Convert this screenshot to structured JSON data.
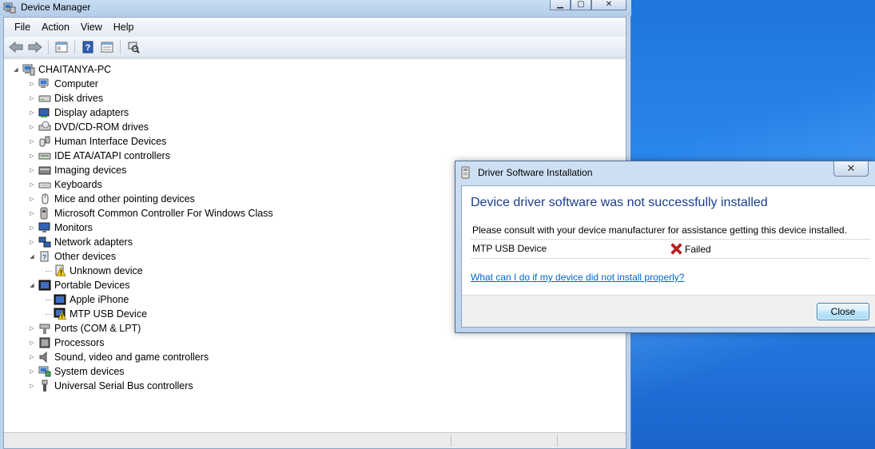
{
  "device_manager": {
    "title": "Device Manager",
    "menu": [
      "File",
      "Action",
      "View",
      "Help"
    ],
    "tree": {
      "root": "CHAITANYA-PC",
      "items": [
        {
          "label": "Computer",
          "icon": "computer-icon",
          "expanded": false
        },
        {
          "label": "Disk drives",
          "icon": "disk-drive-icon",
          "expanded": false
        },
        {
          "label": "Display adapters",
          "icon": "display-adapter-icon",
          "expanded": false
        },
        {
          "label": "DVD/CD-ROM drives",
          "icon": "dvd-drive-icon",
          "expanded": false
        },
        {
          "label": "Human Interface Devices",
          "icon": "hid-icon",
          "expanded": false
        },
        {
          "label": "IDE ATA/ATAPI controllers",
          "icon": "ide-controller-icon",
          "expanded": false
        },
        {
          "label": "Imaging devices",
          "icon": "imaging-device-icon",
          "expanded": false
        },
        {
          "label": "Keyboards",
          "icon": "keyboard-icon",
          "expanded": false
        },
        {
          "label": "Mice and other pointing devices",
          "icon": "mouse-icon",
          "expanded": false
        },
        {
          "label": "Microsoft Common Controller For Windows Class",
          "icon": "controller-icon",
          "expanded": false
        },
        {
          "label": "Monitors",
          "icon": "monitor-icon",
          "expanded": false
        },
        {
          "label": "Network adapters",
          "icon": "network-adapter-icon",
          "expanded": false
        },
        {
          "label": "Other devices",
          "icon": "other-devices-icon",
          "expanded": true,
          "children": [
            {
              "label": "Unknown device",
              "icon": "unknown-device-warning-icon"
            }
          ]
        },
        {
          "label": "Portable Devices",
          "icon": "portable-device-icon",
          "expanded": true,
          "children": [
            {
              "label": "Apple iPhone",
              "icon": "portable-device-icon"
            },
            {
              "label": "MTP USB Device",
              "icon": "portable-device-warning-icon"
            }
          ]
        },
        {
          "label": "Ports (COM & LPT)",
          "icon": "port-icon",
          "expanded": false
        },
        {
          "label": "Processors",
          "icon": "processor-icon",
          "expanded": false
        },
        {
          "label": "Sound, video and game controllers",
          "icon": "sound-icon",
          "expanded": false
        },
        {
          "label": "System devices",
          "icon": "system-device-icon",
          "expanded": false
        },
        {
          "label": "Universal Serial Bus controllers",
          "icon": "usb-icon",
          "expanded": false
        }
      ]
    }
  },
  "dialog": {
    "title": "Driver Software Installation",
    "close_glyph": "✕",
    "heading": "Device driver software was not successfully installed",
    "description": "Please consult with your device manufacturer for assistance getting this device installed.",
    "device_name": "MTP USB Device",
    "status": "Failed",
    "help_link": "What can I do if my device did not install properly?",
    "close_label": "Close"
  },
  "colors": {
    "heading": "#1a3e8c",
    "link": "#0066cc",
    "failed": "#d52020",
    "desktop": "#1f76dc"
  }
}
